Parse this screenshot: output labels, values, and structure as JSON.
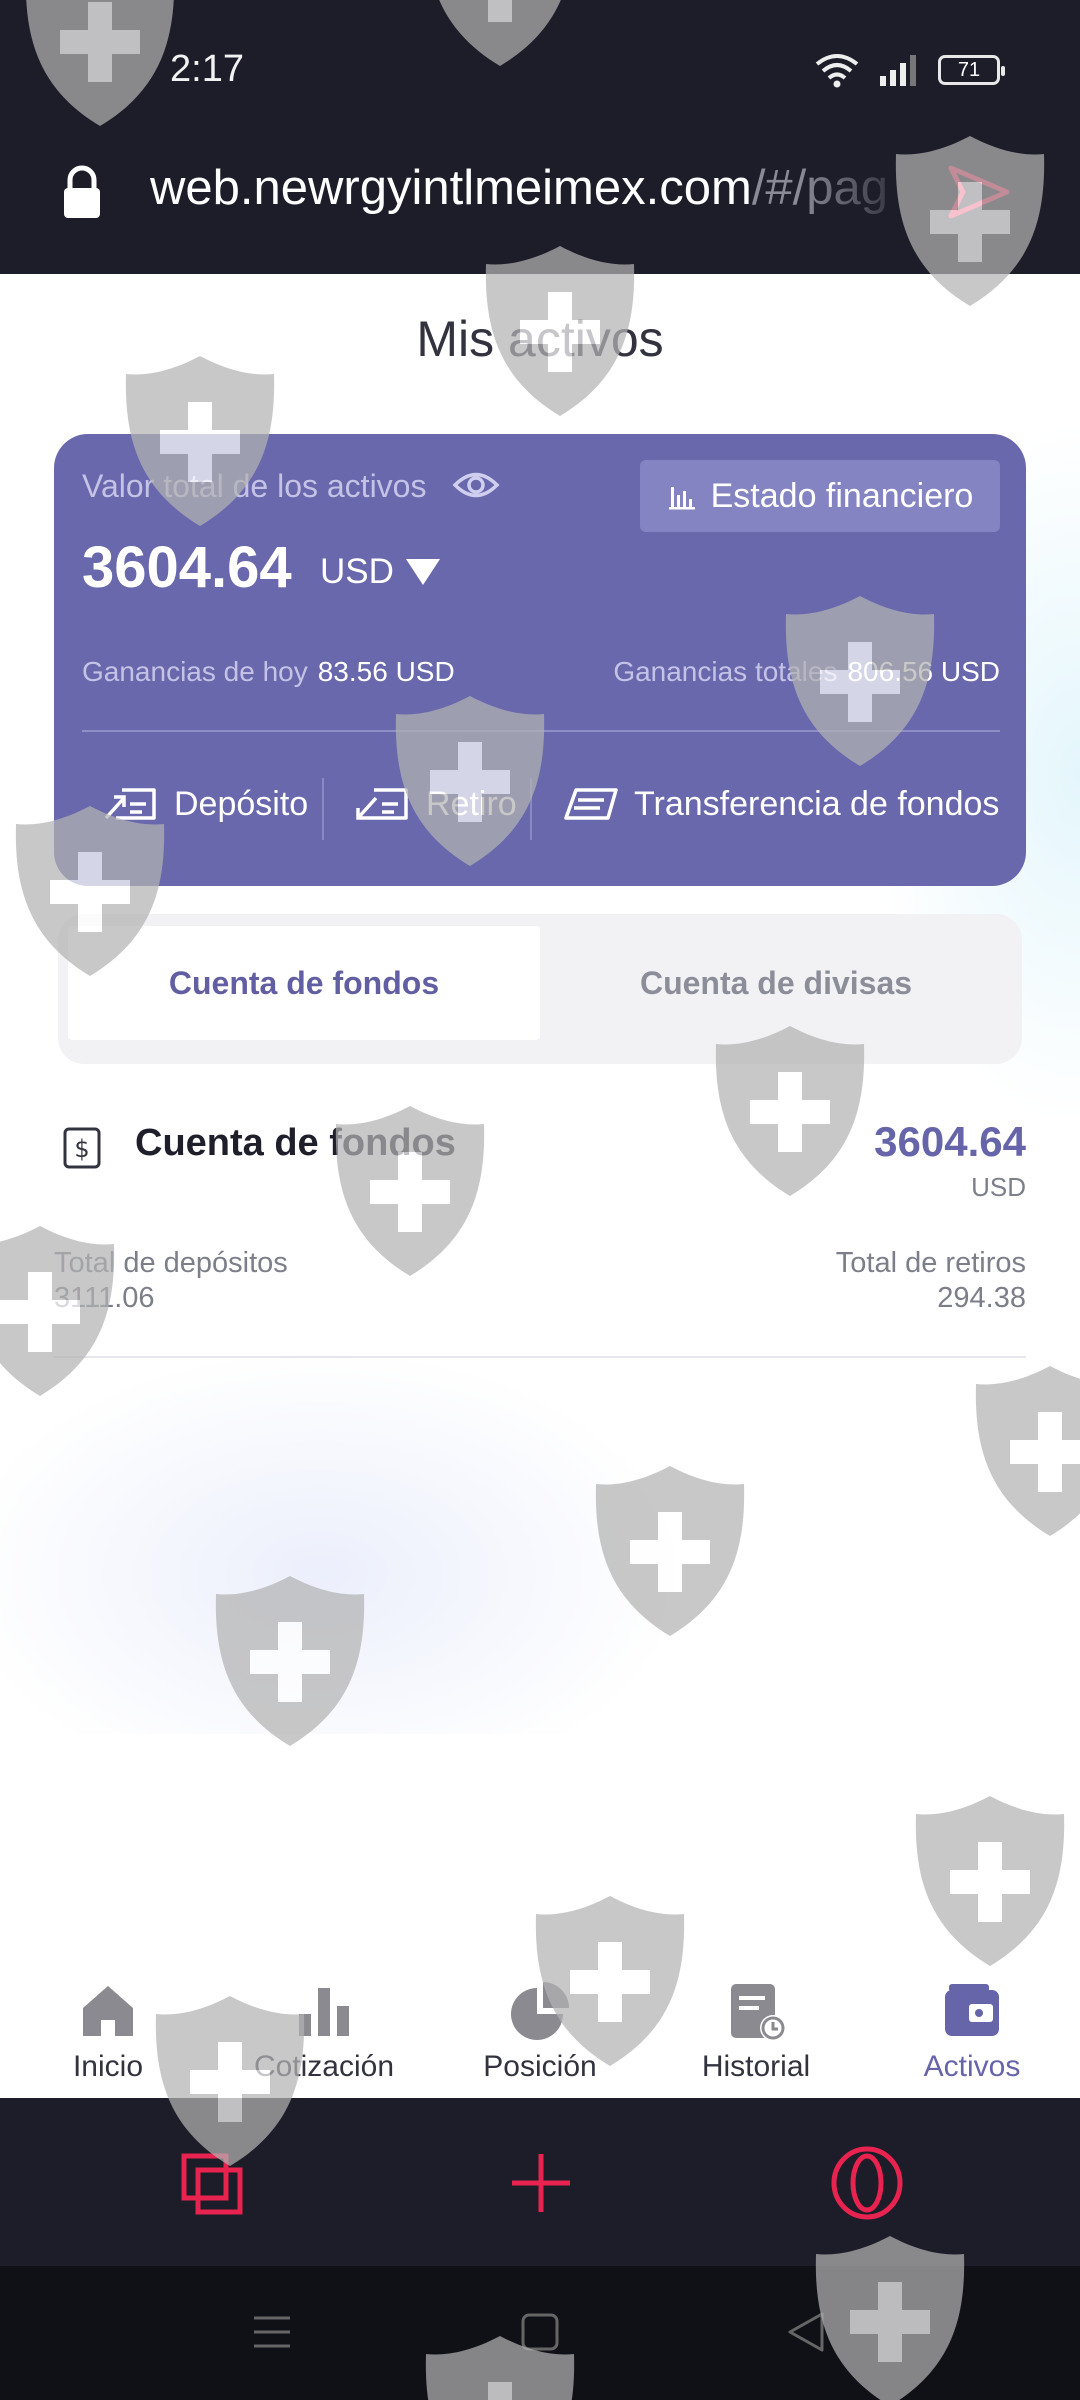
{
  "status_bar": {
    "time": "2:17",
    "battery": "71"
  },
  "browser": {
    "url_host": "web.newrgyintlmeimex.com",
    "url_path": "/#/pag"
  },
  "page": {
    "title": "Mis activos"
  },
  "assets_card": {
    "label": "Valor total de los activos",
    "financial_button": "Estado financiero",
    "total": "3604.64",
    "currency": "USD",
    "today_label": "Ganancias de hoy",
    "today_value": "83.56 USD",
    "total_label": "Ganancias totales",
    "total_value": "806.56 USD",
    "actions": {
      "deposit": "Depósito",
      "withdraw": "Retiro",
      "transfer": "Transferencia de fondos"
    }
  },
  "tabs": [
    {
      "label": "Cuenta de fondos",
      "active": true
    },
    {
      "label": "Cuenta de divisas",
      "active": false
    }
  ],
  "account": {
    "title": "Cuenta de fondos",
    "amount": "3604.64",
    "currency": "USD",
    "deposits_label": "Total de depósitos",
    "deposits_value": "3111.06",
    "withdrawals_label": "Total de retiros",
    "withdrawals_value": "294.38"
  },
  "bottom_nav": [
    {
      "label": "Inicio",
      "icon": "home-icon"
    },
    {
      "label": "Cotización",
      "icon": "bar-chart-icon"
    },
    {
      "label": "Posición",
      "icon": "pie-chart-icon"
    },
    {
      "label": "Historial",
      "icon": "history-icon"
    },
    {
      "label": "Activos",
      "icon": "wallet-icon",
      "active": true
    }
  ],
  "colors": {
    "accent": "#6a68ad",
    "browser_accent": "#e8234f",
    "dark_bar": "#1d1c29"
  }
}
